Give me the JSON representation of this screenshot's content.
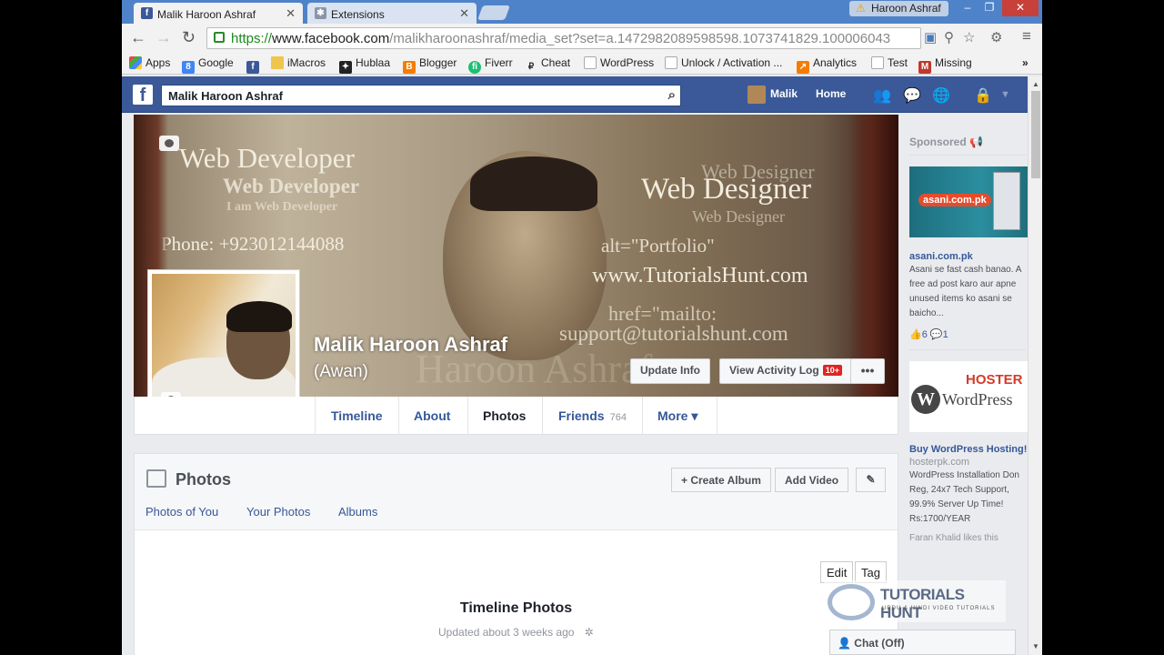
{
  "browser": {
    "tabs": [
      {
        "title": "Malik Haroon Ashraf",
        "icon": "facebook-icon"
      },
      {
        "title": "Extensions",
        "icon": "puzzle-icon"
      }
    ],
    "user": "Haroon Ashraf",
    "url_scheme": "https://",
    "url_host": "www.facebook.com",
    "url_path": "/malikharoonashraf/media_set?set=a.1472982089598598.1073741829.100006043",
    "bookmarks": [
      {
        "label": "Apps",
        "icon": "apps-grid-icon"
      },
      {
        "label": "Google",
        "icon": "google-icon"
      },
      {
        "label": "",
        "icon": "facebook-icon"
      },
      {
        "label": "iMacros",
        "icon": "folder-icon"
      },
      {
        "label": "Hublaa",
        "icon": "hublaa-icon"
      },
      {
        "label": "Blogger",
        "icon": "blogger-icon"
      },
      {
        "label": "Fiverr",
        "icon": "fiverr-icon"
      },
      {
        "label": "Cheat",
        "icon": "cheat-icon"
      },
      {
        "label": "WordPress",
        "icon": "page-icon"
      },
      {
        "label": "Unlock / Activation ...",
        "icon": "page-icon"
      },
      {
        "label": "Analytics",
        "icon": "analytics-icon"
      },
      {
        "label": "Test",
        "icon": "page-icon"
      },
      {
        "label": "Missing",
        "icon": "missing-icon"
      }
    ],
    "bookmarks_more": "»"
  },
  "fb": {
    "search_value": "Malik Haroon Ashraf",
    "nav_user": "Malik",
    "nav_home": "Home"
  },
  "cover": {
    "lines": [
      "Web Developer",
      "Web Developer",
      "I am Web Developer",
      "Phone: +923012144088",
      "Web Designer",
      "Web Designer",
      "Web Designer",
      "alt=\"Portfolio\"",
      "www.TutorialsHunt.com",
      "href=\"mailto:",
      "support@tutorialshunt.com",
      "Haroon Ashraf"
    ]
  },
  "profile": {
    "name": "Malik Haroon Ashraf",
    "alt_name": "(Awan)",
    "update_info": "Update Info",
    "view_activity": "View Activity Log",
    "activity_badge": "10+",
    "more_dots": "•••"
  },
  "nav_tabs": [
    {
      "label": "Timeline",
      "count": ""
    },
    {
      "label": "About",
      "count": ""
    },
    {
      "label": "Photos",
      "count": ""
    },
    {
      "label": "Friends",
      "count": "764"
    },
    {
      "label": "More ▾",
      "count": ""
    }
  ],
  "photos": {
    "title": "Photos",
    "create_album": "+ Create Album",
    "add_video": "Add Video",
    "edit_icon": "✎",
    "subtabs": [
      "Photos of You",
      "Your Photos",
      "Albums"
    ],
    "edit": "Edit",
    "tag": "Tag",
    "timeline_title": "Timeline Photos",
    "timeline_updated": "Updated about 3 weeks ago"
  },
  "sidebar": {
    "sponsored": "Sponsored",
    "ad1": {
      "brand": "asani.com.pk",
      "title": "asani.com.pk",
      "desc": "Asani se fast cash banao. A free ad post karo aur apne unused items ko asani se baicho...",
      "likes": "6",
      "comments": "1"
    },
    "ad2": {
      "brand1": "HOSTER",
      "brand2": "WordPress",
      "title": "Buy WordPress Hosting!",
      "url": "hosterpk.com",
      "desc": "WordPress Installation Don Reg, 24x7 Tech Support, 99.9% Server Up Time! Rs:1700/YEAR",
      "social": "Faran Khalid likes this"
    }
  },
  "watermark": {
    "title": "TUTORIALS HUNT",
    "sub": "URDU & HINDI VIDEO TUTORIALS"
  },
  "chat": "Chat (Off)",
  "colors": {
    "fb_blue": "#3b5998",
    "link": "#365899",
    "chrome_frame": "#4f83c9"
  }
}
